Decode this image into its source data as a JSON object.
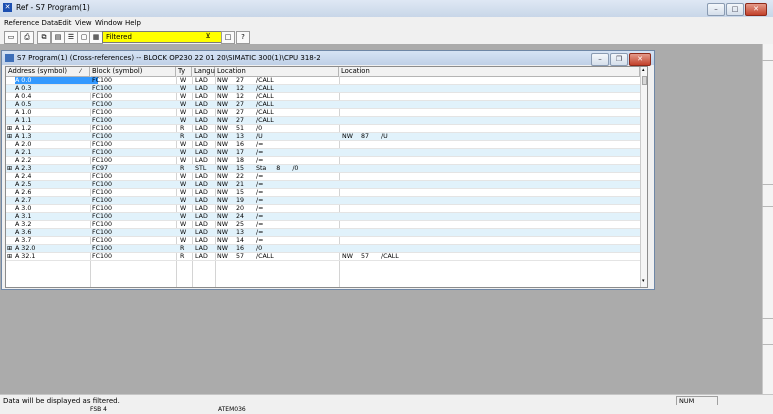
{
  "window": {
    "title": "Ref - S7 Program(1)"
  },
  "menu": [
    "Reference Data",
    "Edit",
    "View",
    "Window",
    "Help"
  ],
  "toolbar": {
    "filter_value": "Filtered"
  },
  "child": {
    "title": "S7 Program(1) (Cross-references) -- BLOCK OP230 22 01 20\\SIMATIC 300(1)\\CPU 318-2"
  },
  "columns": [
    "Address (symbol)",
    "Block (symbol)",
    "Ty",
    "Langu",
    "Location",
    "Location"
  ],
  "rows": [
    {
      "addr": "A 0.0",
      "block": "FC100",
      "ty": "W",
      "lang": "LAD",
      "loc1": "NW    27      /CALL",
      "loc2": "",
      "exp": ""
    },
    {
      "addr": "A 0.3",
      "block": "FC100",
      "ty": "W",
      "lang": "LAD",
      "loc1": "NW    12      /CALL",
      "loc2": "",
      "exp": ""
    },
    {
      "addr": "A 0.4",
      "block": "FC100",
      "ty": "W",
      "lang": "LAD",
      "loc1": "NW    12      /CALL",
      "loc2": "",
      "exp": ""
    },
    {
      "addr": "A 0.5",
      "block": "FC100",
      "ty": "W",
      "lang": "LAD",
      "loc1": "NW    27      /CALL",
      "loc2": "",
      "exp": ""
    },
    {
      "addr": "A 1.0",
      "block": "FC100",
      "ty": "W",
      "lang": "LAD",
      "loc1": "NW    27      /CALL",
      "loc2": "",
      "exp": ""
    },
    {
      "addr": "A 1.1",
      "block": "FC100",
      "ty": "W",
      "lang": "LAD",
      "loc1": "NW    27      /CALL",
      "loc2": "",
      "exp": ""
    },
    {
      "addr": "A 1.2",
      "block": "FC100",
      "ty": "R",
      "lang": "LAD",
      "loc1": "NW    51      /0",
      "loc2": "",
      "exp": "⊞"
    },
    {
      "addr": "A 1.3",
      "block": "FC100",
      "ty": "R",
      "lang": "LAD",
      "loc1": "NW    13      /U",
      "loc2": "NW    87      /U",
      "exp": "⊞"
    },
    {
      "addr": "A 2.0",
      "block": "FC100",
      "ty": "W",
      "lang": "LAD",
      "loc1": "NW    16      /=",
      "loc2": "",
      "exp": ""
    },
    {
      "addr": "A 2.1",
      "block": "FC100",
      "ty": "W",
      "lang": "LAD",
      "loc1": "NW    17      /=",
      "loc2": "",
      "exp": ""
    },
    {
      "addr": "A 2.2",
      "block": "FC100",
      "ty": "W",
      "lang": "LAD",
      "loc1": "NW    18      /=",
      "loc2": "",
      "exp": ""
    },
    {
      "addr": "A 2.3",
      "block": "FC97",
      "ty": "R",
      "lang": "STL",
      "loc1": "NW    15      Sta     8      /0",
      "loc2": "",
      "exp": "⊞"
    },
    {
      "addr": "A 2.4",
      "block": "FC100",
      "ty": "W",
      "lang": "LAD",
      "loc1": "NW    22      /=",
      "loc2": "",
      "exp": ""
    },
    {
      "addr": "A 2.5",
      "block": "FC100",
      "ty": "W",
      "lang": "LAD",
      "loc1": "NW    21      /=",
      "loc2": "",
      "exp": ""
    },
    {
      "addr": "A 2.6",
      "block": "FC100",
      "ty": "W",
      "lang": "LAD",
      "loc1": "NW    15      /=",
      "loc2": "",
      "exp": ""
    },
    {
      "addr": "A 2.7",
      "block": "FC100",
      "ty": "W",
      "lang": "LAD",
      "loc1": "NW    19      /=",
      "loc2": "",
      "exp": ""
    },
    {
      "addr": "A 3.0",
      "block": "FC100",
      "ty": "W",
      "lang": "LAD",
      "loc1": "NW    20      /=",
      "loc2": "",
      "exp": ""
    },
    {
      "addr": "A 3.1",
      "block": "FC100",
      "ty": "W",
      "lang": "LAD",
      "loc1": "NW    24      /=",
      "loc2": "",
      "exp": ""
    },
    {
      "addr": "A 3.2",
      "block": "FC100",
      "ty": "W",
      "lang": "LAD",
      "loc1": "NW    25      /=",
      "loc2": "",
      "exp": ""
    },
    {
      "addr": "A 3.6",
      "block": "FC100",
      "ty": "W",
      "lang": "LAD",
      "loc1": "NW    13      /=",
      "loc2": "",
      "exp": ""
    },
    {
      "addr": "A 3.7",
      "block": "FC100",
      "ty": "W",
      "lang": "LAD",
      "loc1": "NW    14      /=",
      "loc2": "",
      "exp": ""
    },
    {
      "addr": "A 32.0",
      "block": "FC100",
      "ty": "R",
      "lang": "LAD",
      "loc1": "NW    16      /0",
      "loc2": "",
      "exp": "⊞"
    },
    {
      "addr": "A 32.1",
      "block": "FC100",
      "ty": "R",
      "lang": "LAD",
      "loc1": "NW    57      /CALL",
      "loc2": "NW    57      /CALL",
      "exp": "⊞"
    }
  ],
  "status": {
    "text": "Data will be displayed as filtered.",
    "num": "NUM"
  },
  "bottom": {
    "left": "FSB 4",
    "right": "ATEM036"
  }
}
